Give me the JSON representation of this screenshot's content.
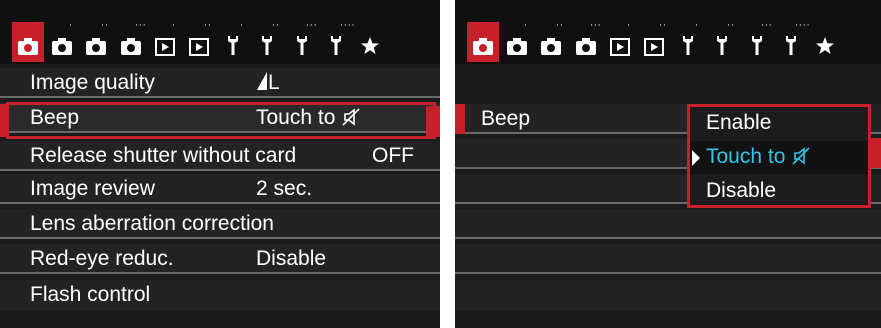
{
  "colors": {
    "accent": "#c8202a",
    "highlight_text": "#35c4ea",
    "text": "#ffffff",
    "background": "#1b1b1b"
  },
  "tabs": [
    {
      "icon": "camera-icon",
      "dots": "",
      "active": true
    },
    {
      "icon": "camera-icon",
      "dots": "·"
    },
    {
      "icon": "camera-icon",
      "dots": "··"
    },
    {
      "icon": "camera-icon",
      "dots": "···"
    },
    {
      "icon": "playback-icon",
      "dots": "·"
    },
    {
      "icon": "playback-icon",
      "dots": "··"
    },
    {
      "icon": "wrench-icon",
      "dots": "·"
    },
    {
      "icon": "wrench-icon",
      "dots": "··"
    },
    {
      "icon": "wrench-icon",
      "dots": "···"
    },
    {
      "icon": "wrench-icon",
      "dots": "····"
    },
    {
      "icon": "star-icon",
      "dots": ""
    }
  ],
  "left_menu": {
    "items": [
      {
        "label": "Image quality",
        "value": "L",
        "value_icon": "quality-fine-icon"
      },
      {
        "label": "Beep",
        "value": "Touch to",
        "value_icon": "speaker-mute-icon",
        "selected": true
      },
      {
        "label": "Release shutter without card",
        "value": "OFF"
      },
      {
        "label": "Image review",
        "value": "2 sec."
      },
      {
        "label": "Lens aberration correction",
        "value": ""
      },
      {
        "label": "Red-eye reduc.",
        "value": "Disable"
      },
      {
        "label": "Flash control",
        "value": ""
      }
    ]
  },
  "right_menu": {
    "setting_label": "Beep",
    "options": [
      {
        "label": "Enable"
      },
      {
        "label": "Touch to",
        "icon": "speaker-mute-icon",
        "current": true
      },
      {
        "label": "Disable"
      }
    ]
  }
}
